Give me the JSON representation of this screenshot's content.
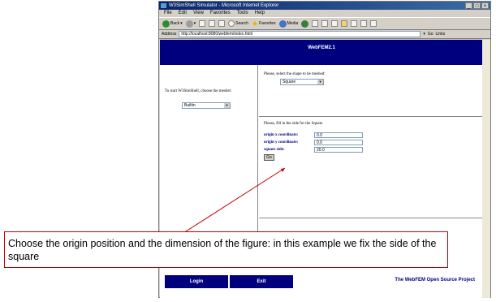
{
  "browser": {
    "title": "W3SimShell Simulator - Microsoft Internet Explorer",
    "menu": [
      "File",
      "Edit",
      "View",
      "Favorites",
      "Tools",
      "Help"
    ],
    "toolbar": {
      "back": "Back",
      "search": "Search",
      "favorites": "Favorites",
      "media": "Media"
    },
    "address_label": "Address",
    "address_value": "http://localhost:8080/webfem/index.html",
    "go": "Go",
    "links": "Links"
  },
  "page": {
    "header_title": "WebFEM2.1",
    "left_prompt": "To start W3SimShell, choose the mesher:",
    "mesher_value": "Builtin",
    "shape_prompt": "Please, select the shape to be meshed:",
    "shape_value": "Square",
    "fill_prompt": "Please, fill in the side for the Square",
    "fields": [
      {
        "label": "origin x coordinate:",
        "value": "0.0"
      },
      {
        "label": "origin y coordinate:",
        "value": "0.0"
      },
      {
        "label": "square side:",
        "value": "20.0"
      }
    ],
    "go_button": "Go",
    "login": "Login",
    "exit": "Exit",
    "project": "The WebFEM Open Source Project"
  },
  "callout": {
    "text": "Choose the origin position and the dimension of the figure: in this example we fix the side of the square",
    "color": "#c00000"
  }
}
